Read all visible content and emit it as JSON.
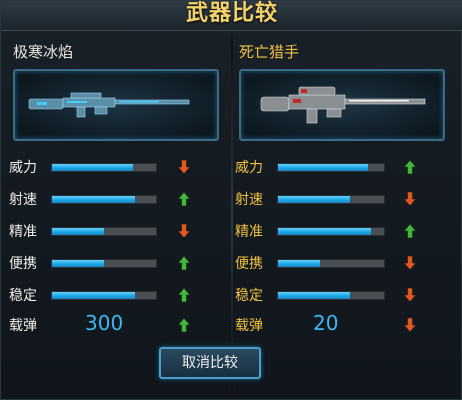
{
  "window": {
    "title": "武器比较"
  },
  "left_weapon": {
    "name": "极寒冰焰",
    "stats": [
      {
        "label": "威力",
        "level": 0.78,
        "trend": "down"
      },
      {
        "label": "射速",
        "level": 0.8,
        "trend": "up"
      },
      {
        "label": "精准",
        "level": 0.5,
        "trend": "down"
      },
      {
        "label": "便携",
        "level": 0.5,
        "trend": "up"
      },
      {
        "label": "稳定",
        "level": 0.8,
        "trend": "up"
      }
    ],
    "ammo": {
      "label": "载弹",
      "value": "300",
      "trend": "up"
    }
  },
  "right_weapon": {
    "name": "死亡猎手",
    "stats": [
      {
        "label": "威力",
        "level": 0.85,
        "trend": "up"
      },
      {
        "label": "射速",
        "level": 0.68,
        "trend": "down"
      },
      {
        "label": "精准",
        "level": 0.88,
        "trend": "up"
      },
      {
        "label": "便携",
        "level": 0.4,
        "trend": "down"
      },
      {
        "label": "稳定",
        "level": 0.68,
        "trend": "down"
      }
    ],
    "ammo": {
      "label": "载弹",
      "value": "20",
      "trend": "down"
    }
  },
  "footer": {
    "cancel_label": "取消比较"
  },
  "colors": {
    "up": "#3fb83a",
    "down": "#e0571f",
    "bar": "#1ea2e6",
    "title": "#f4d36a"
  },
  "icons": {
    "up": "arrow-up-icon",
    "down": "arrow-down-icon"
  }
}
